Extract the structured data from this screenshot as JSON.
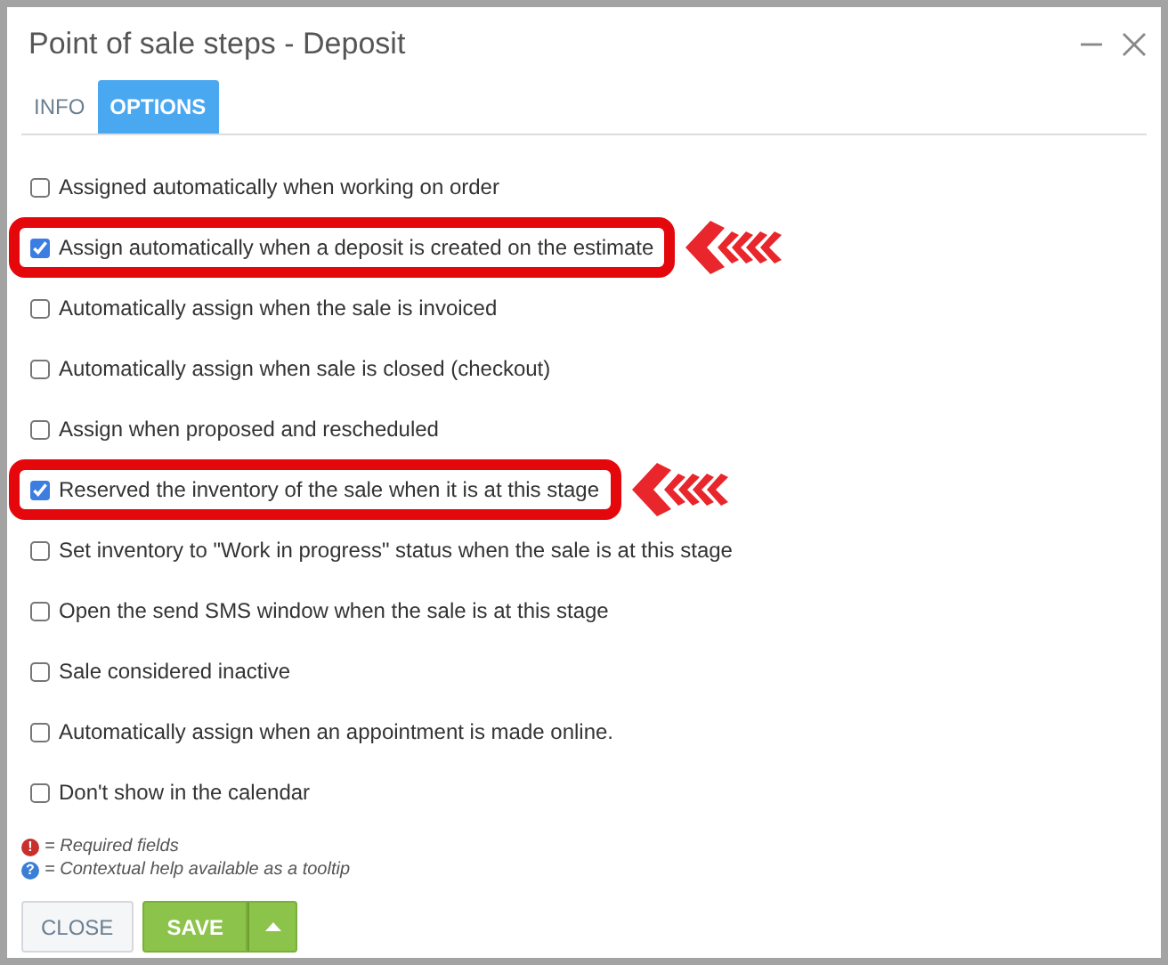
{
  "window": {
    "title": "Point of sale steps - Deposit"
  },
  "tabs": [
    {
      "label": "INFO",
      "selected": false
    },
    {
      "label": "OPTIONS",
      "selected": true
    }
  ],
  "options": [
    {
      "label": "Assigned automatically when working on order",
      "checked": false,
      "highlighted": false
    },
    {
      "label": "Assign automatically when a deposit is created on the estimate",
      "checked": true,
      "highlighted": true
    },
    {
      "label": "Automatically assign when the sale is invoiced",
      "checked": false,
      "highlighted": false
    },
    {
      "label": "Automatically assign when sale is closed (checkout)",
      "checked": false,
      "highlighted": false
    },
    {
      "label": "Assign when proposed and rescheduled",
      "checked": false,
      "highlighted": false
    },
    {
      "label": "Reserved the inventory of the sale when it is at this stage",
      "checked": true,
      "highlighted": true
    },
    {
      "label": "Set inventory to \"Work in progress\" status when the sale is at this stage",
      "checked": false,
      "highlighted": false
    },
    {
      "label": "Open the send SMS window when the sale is at this stage",
      "checked": false,
      "highlighted": false
    },
    {
      "label": "Sale considered inactive",
      "checked": false,
      "highlighted": false
    },
    {
      "label": "Automatically assign when an appointment is made online.",
      "checked": false,
      "highlighted": false
    },
    {
      "label": "Don't show in the calendar",
      "checked": false,
      "highlighted": false
    }
  ],
  "legend": [
    {
      "symbol": "!",
      "text": "= Required fields",
      "kind": "required"
    },
    {
      "symbol": "?",
      "text": "= Contextual help available as a tooltip",
      "kind": "help"
    }
  ],
  "buttons": {
    "close": "CLOSE",
    "save": "SAVE"
  }
}
